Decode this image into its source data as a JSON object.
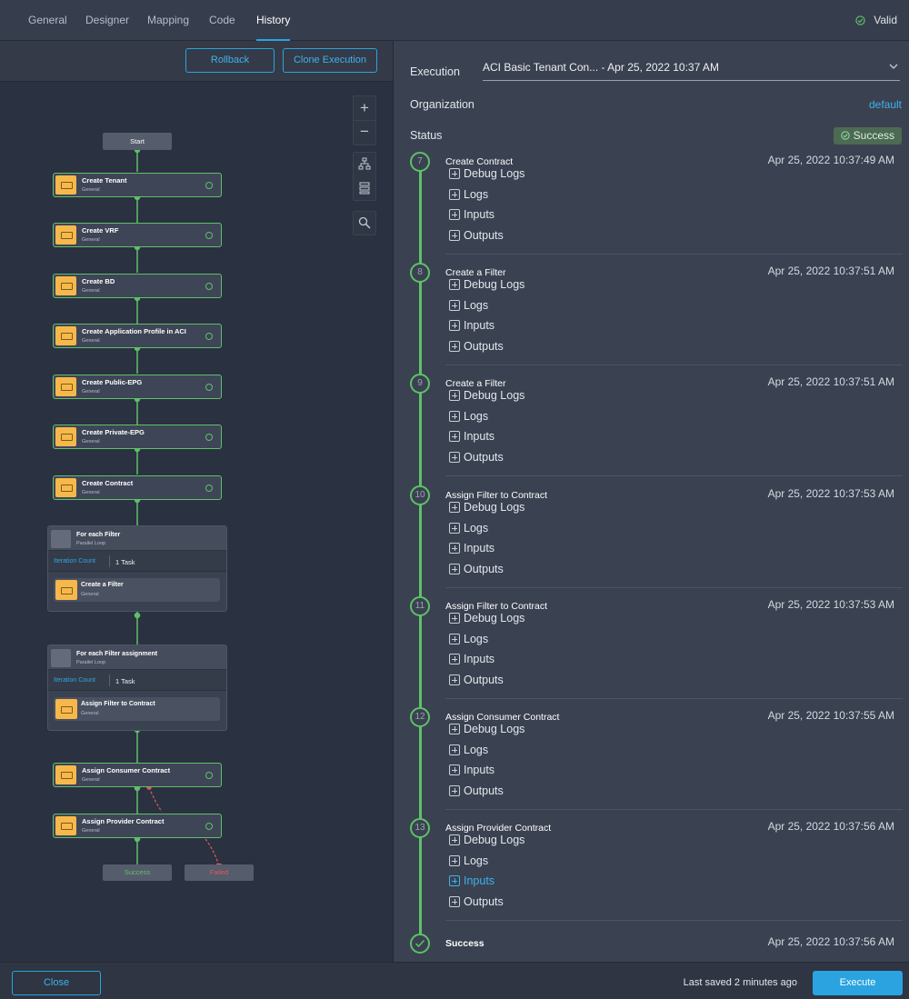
{
  "tabs": [
    {
      "label": "General"
    },
    {
      "label": "Designer"
    },
    {
      "label": "Mapping"
    },
    {
      "label": "Code"
    },
    {
      "label": "History",
      "active": true
    }
  ],
  "validity": "Valid",
  "toolbar": {
    "rollback_label": "Rollback",
    "clone_label": "Clone Execution"
  },
  "workflow": {
    "start_label": "Start",
    "nodes": [
      {
        "title": "Create Tenant",
        "subtitle": "General"
      },
      {
        "title": "Create VRF",
        "subtitle": "General"
      },
      {
        "title": "Create BD",
        "subtitle": "General"
      },
      {
        "title": "Create Application Profile in ACI",
        "subtitle": "General"
      },
      {
        "title": "Create Public-EPG",
        "subtitle": "General"
      },
      {
        "title": "Create Private-EPG",
        "subtitle": "General"
      },
      {
        "title": "Create Contract",
        "subtitle": "General"
      }
    ],
    "loops": [
      {
        "title": "For each Filter",
        "subtitle": "Parallel Loop",
        "iteration_label": "Iteration Count",
        "iteration_value": "1 Task",
        "inner_title": "Create a Filter",
        "inner_subtitle": "General"
      },
      {
        "title": "For each Filter assignment",
        "subtitle": "Parallel Loop",
        "iteration_label": "Iteration Count",
        "iteration_value": "1 Task",
        "inner_title": "Assign Filter to Contract",
        "inner_subtitle": "General"
      }
    ],
    "tail_nodes": [
      {
        "title": "Assign Consumer Contract",
        "subtitle": "General"
      },
      {
        "title": "Assign Provider Contract",
        "subtitle": "General"
      }
    ],
    "success_label": "Success",
    "failed_label": "Failed"
  },
  "details": {
    "execution_label": "Execution",
    "execution_value": "ACI Basic Tenant Con... - Apr 25, 2022 10:37 AM",
    "organization_label": "Organization",
    "organization_value": "default",
    "status_label": "Status",
    "status_value": "Success",
    "item_labels": [
      "Debug Logs",
      "Logs",
      "Inputs",
      "Outputs"
    ],
    "steps": [
      {
        "num": "7",
        "name": "Create Contract",
        "time": "Apr 25, 2022 10:37:49 AM"
      },
      {
        "num": "8",
        "name": "Create a Filter",
        "time": "Apr 25, 2022 10:37:51 AM"
      },
      {
        "num": "9",
        "name": "Create a Filter",
        "time": "Apr 25, 2022 10:37:51 AM"
      },
      {
        "num": "10",
        "name": "Assign Filter to Contract",
        "time": "Apr 25, 2022 10:37:53 AM"
      },
      {
        "num": "11",
        "name": "Assign Filter to Contract",
        "time": "Apr 25, 2022 10:37:53 AM"
      },
      {
        "num": "12",
        "name": "Assign Consumer Contract",
        "time": "Apr 25, 2022 10:37:55 AM"
      },
      {
        "num": "13",
        "name": "Assign Provider Contract",
        "time": "Apr 25, 2022 10:37:56 AM",
        "highlight_item": 2
      }
    ],
    "final": {
      "name": "Success",
      "time": "Apr 25, 2022 10:37:56 AM"
    }
  },
  "footer": {
    "close_label": "Close",
    "last_saved": "Last saved 2 minutes ago",
    "execute_label": "Execute"
  },
  "colors": {
    "accent": "#2aa3e0",
    "success": "#5fc06a",
    "failure": "#e05a5a",
    "task_icon": "#f7b84b"
  }
}
